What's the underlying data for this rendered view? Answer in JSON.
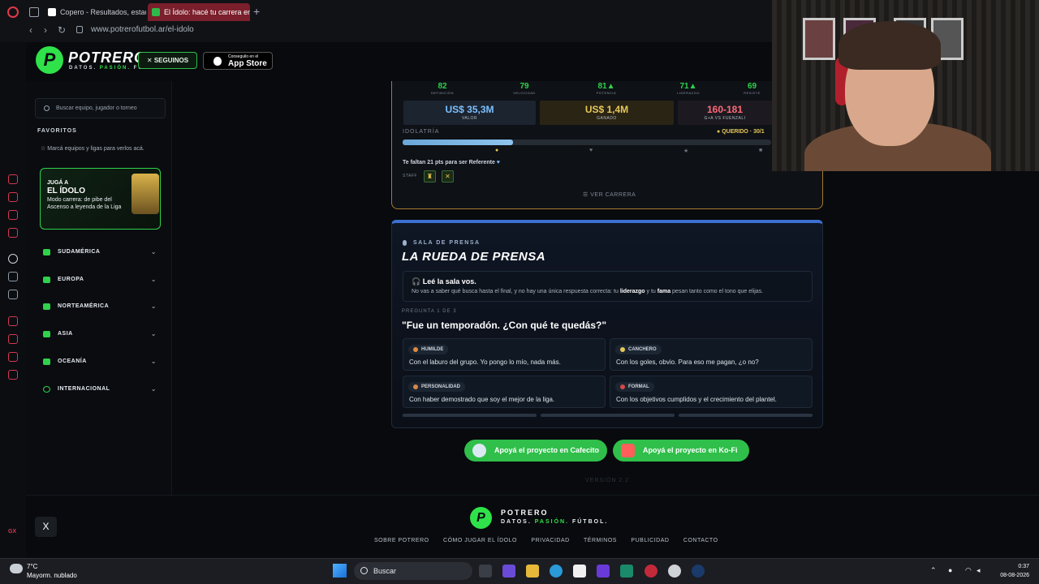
{
  "browser": {
    "tabs": [
      {
        "label": "Copero - Resultados, estad"
      },
      {
        "label": "El Ídolo: hacé tu carrera en"
      }
    ],
    "new_tab": "+",
    "url": "www.potrerofutbol.ar/el-idolo"
  },
  "header": {
    "logo_letter": "P",
    "logo_name": "POTRERO",
    "logo_tag_1": "DATOS. ",
    "logo_tag_2": "PASIÓN.",
    "logo_tag_3": " FÚTBOL.",
    "follow_label": "SEGUINOS",
    "appstore_small": "Conseguilo en el",
    "appstore_large": "App Store"
  },
  "sidebar": {
    "search_placeholder": "Buscar equipo, jugador o torneo",
    "favorites_title": "FAVORITOS",
    "favorites_hint": "Marcá equipos y ligas para verlos acá.",
    "promo": {
      "kicker": "JUGÁ A",
      "title": "EL ÍDOLO",
      "desc": "Modo carrera: de pibe del Ascenso a leyenda de la Liga"
    },
    "regions": [
      {
        "label": "SUDAMÉRICA"
      },
      {
        "label": "EUROPA"
      },
      {
        "label": "NORTEAMÉRICA"
      },
      {
        "label": "ASIA"
      },
      {
        "label": "OCEANÍA"
      },
      {
        "label": "INTERNACIONAL"
      }
    ]
  },
  "career": {
    "stats": [
      {
        "value": "82",
        "label": "DEFINICIÓN"
      },
      {
        "value": "79",
        "label": "VELOCIDAD"
      },
      {
        "value": "81▲",
        "label": "POTENCIA"
      },
      {
        "value": "71▲",
        "label": "LIDERAZGO"
      },
      {
        "value": "69",
        "label": "RESISTE"
      }
    ],
    "money": [
      {
        "value": "US$ 35,3M",
        "label": "VALOR"
      },
      {
        "value": "US$ 1,4M",
        "label": "GANADO"
      },
      {
        "value": "160-181",
        "label": "G+A VS FUENZALI"
      }
    ],
    "idolatria_label": "IDOLATRÍA",
    "idolatria_state": "QUERIDO · 30/1",
    "idolatria_progress": 30,
    "note": "Te faltan 21 pts para ser Referente",
    "staff_label": "STAFF",
    "view_career": "VER CARRERA"
  },
  "press": {
    "kicker": "SALA DE PRENSA",
    "title": "LA RUEDA DE PRENSA",
    "info_title": "Leé la sala vos.",
    "info_text_1": "No vas a saber qué busca hasta el final, y no hay una única respuesta correcta: tu ",
    "info_bold_1": "liderazgo",
    "info_text_2": " y tu ",
    "info_bold_2": "fama",
    "info_text_3": " pesan tanto como el tono que elijas.",
    "question_label": "PREGUNTA 1 DE 3",
    "question": "\"Fue un temporadón. ¿Con qué te quedás?\"",
    "options": [
      {
        "tag": "HUMILDE",
        "text": "Con el laburo del grupo. Yo pongo lo mío, nada más.",
        "color": "#e08a3a"
      },
      {
        "tag": "CANCHERO",
        "text": "Con los goles, obvio. Para eso me pagan, ¿o no?",
        "color": "#e6c85a"
      },
      {
        "tag": "PERSONALIDAD",
        "text": "Con haber demostrado que soy el mejor de la liga.",
        "color": "#d9884a"
      },
      {
        "tag": "FORMAL",
        "text": "Con los objetivos cumplidos y el crecimiento del plantel.",
        "color": "#d24a4a"
      }
    ]
  },
  "support": {
    "cafecito": "Apoyá el proyecto en Cafecito",
    "kofi": "Apoyá el proyecto en Ko-Fi"
  },
  "version": "VERSIÓN 2.2",
  "footer": {
    "name": "POTRERO",
    "tag_1": "DATOS. ",
    "tag_2": "PASIÓN.",
    "tag_3": " FÚTBOL.",
    "links": [
      "SOBRE POTRERO",
      "CÓMO JUGAR EL ÍDOLO",
      "PRIVACIDAD",
      "TÉRMINOS",
      "PUBLICIDAD",
      "CONTACTO"
    ],
    "x_label": "X"
  },
  "taskbar": {
    "temp": "7°C",
    "weather": "Mayorm. nublado",
    "search": "Buscar",
    "time": "0:37",
    "date": "08-08-2026"
  },
  "rail": {
    "gx": "GX"
  }
}
